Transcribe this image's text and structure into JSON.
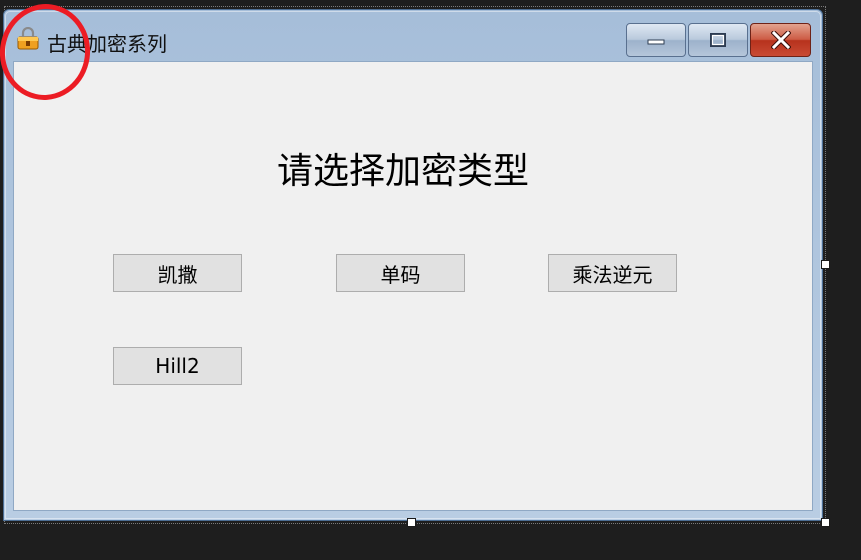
{
  "window": {
    "title": "古典加密系列",
    "controls": {
      "minimize": "minimize-icon",
      "maximize": "maximize-icon",
      "close": "close-icon"
    }
  },
  "main": {
    "heading": "请选择加密类型",
    "buttons": {
      "caesar": "凯撒",
      "single_table": "单码",
      "multiplicative_inverse": "乘法逆元",
      "hill2": "Hill2"
    }
  },
  "colors": {
    "window_frame": "#b9cde3",
    "client_background": "#f0f0f0",
    "button_face": "#e1e1e1",
    "close_button": "#c94b34",
    "annotation_circle": "#ec1c24"
  }
}
